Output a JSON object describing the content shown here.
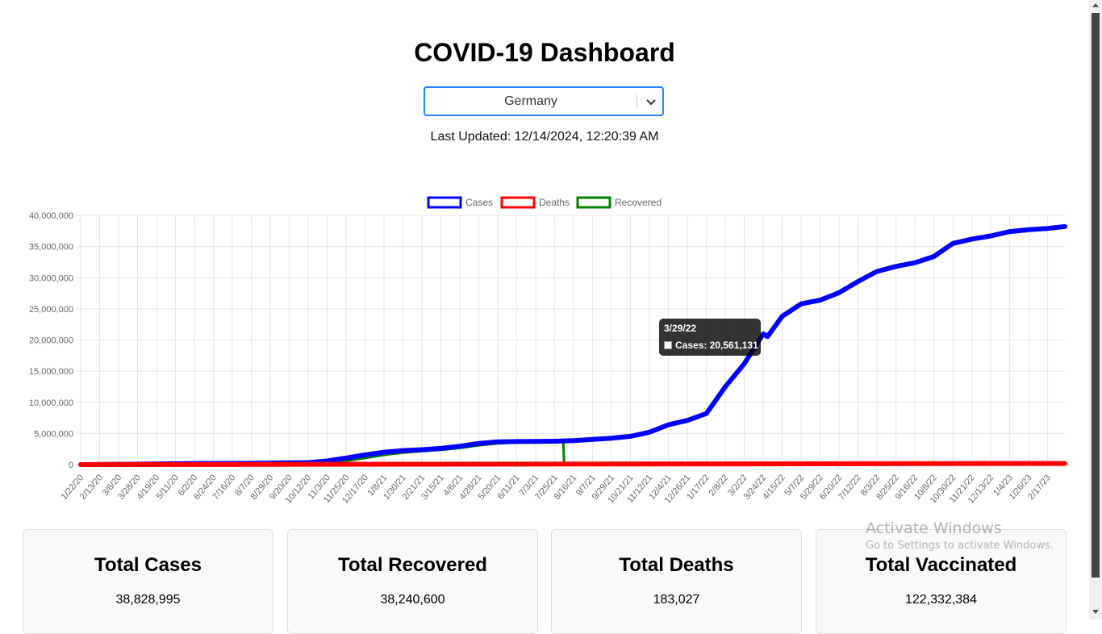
{
  "header": {
    "title": "COVID-19 Dashboard"
  },
  "country_select": {
    "value": "Germany",
    "icon": "chevron-down-icon"
  },
  "last_updated": "Last Updated: 12/14/2024, 12:20:39 AM",
  "chart_data": {
    "type": "line",
    "title": "",
    "xlabel": "",
    "ylabel": "",
    "ylim": [
      0,
      40000000
    ],
    "y_ticks": [
      "0",
      "5,000,000",
      "10,000,000",
      "15,000,000",
      "20,000,000",
      "25,000,000",
      "30,000,000",
      "35,000,000",
      "40,000,000"
    ],
    "x_tick_labels": [
      "1/22/20",
      "2/13/20",
      "3/6/20",
      "3/28/20",
      "4/19/20",
      "5/11/20",
      "6/2/20",
      "6/24/20",
      "7/16/20",
      "8/7/20",
      "8/29/20",
      "9/20/20",
      "10/12/20",
      "11/3/20",
      "11/25/20",
      "12/17/20",
      "1/8/21",
      "1/30/21",
      "2/21/21",
      "3/15/21",
      "4/6/21",
      "4/28/21",
      "5/20/21",
      "6/11/21",
      "7/3/21",
      "7/25/21",
      "8/16/21",
      "9/7/21",
      "9/29/21",
      "10/21/21",
      "11/12/21",
      "12/4/21",
      "12/26/21",
      "1/17/22",
      "2/8/22",
      "3/2/22",
      "3/24/22",
      "4/15/22",
      "5/7/22",
      "5/29/22",
      "6/20/22",
      "7/12/22",
      "8/3/22",
      "8/25/22",
      "9/16/22",
      "10/8/22",
      "10/30/22",
      "11/21/22",
      "12/13/22",
      "1/4/23",
      "1/26/23",
      "2/17/23"
    ],
    "grid": true,
    "legend": "top-center",
    "series": [
      {
        "name": "Cases",
        "color": "#0000ff",
        "x": [
          "1/22/20",
          "3/28/20",
          "6/2/20",
          "8/7/20",
          "10/12/20",
          "11/3/20",
          "11/25/20",
          "12/17/20",
          "1/8/21",
          "1/30/21",
          "2/21/21",
          "3/15/21",
          "4/6/21",
          "4/28/21",
          "5/20/21",
          "6/11/21",
          "7/3/21",
          "7/25/21",
          "8/16/21",
          "9/7/21",
          "9/29/21",
          "10/21/21",
          "11/12/21",
          "12/4/21",
          "12/26/21",
          "1/17/22",
          "2/8/22",
          "3/2/22",
          "3/24/22",
          "3/29/22",
          "4/15/22",
          "5/7/22",
          "5/29/22",
          "6/20/22",
          "7/12/22",
          "8/3/22",
          "8/25/22",
          "9/16/22",
          "10/8/22",
          "10/30/22",
          "11/21/22",
          "12/13/22",
          "1/4/23",
          "1/26/23",
          "2/17/23",
          "3/9/23"
        ],
        "y": [
          0,
          60000,
          180000,
          210000,
          320000,
          580000,
          1050000,
          1550000,
          2000000,
          2250000,
          2400000,
          2600000,
          2950000,
          3400000,
          3650000,
          3700000,
          3720000,
          3760000,
          3850000,
          4050000,
          4250000,
          4550000,
          5200000,
          6400000,
          7100000,
          8200000,
          12500000,
          16200000,
          21000000,
          20561131,
          23800000,
          25800000,
          26400000,
          27600000,
          29400000,
          31000000,
          31800000,
          32400000,
          33400000,
          35500000,
          36200000,
          36700000,
          37400000,
          37700000,
          37900000,
          38200000
        ]
      },
      {
        "name": "Deaths",
        "color": "#ff0000",
        "x": [
          "1/22/20",
          "3/9/23"
        ],
        "y": [
          0,
          183027
        ]
      },
      {
        "name": "Recovered",
        "color": "#008000",
        "x": [
          "1/22/20",
          "3/28/20",
          "6/2/20",
          "8/7/20",
          "10/12/20",
          "11/3/20",
          "11/25/20",
          "12/17/20",
          "1/8/21",
          "1/30/21",
          "2/21/21",
          "3/15/21",
          "4/6/21",
          "4/28/21",
          "5/20/21",
          "6/11/21",
          "7/3/21",
          "7/25/21",
          "8/4/21",
          "8/5/21",
          "8/16/21",
          "3/9/23"
        ],
        "y": [
          0,
          50000,
          160000,
          190000,
          280000,
          380000,
          600000,
          1050000,
          1550000,
          1900000,
          2150000,
          2350000,
          2650000,
          3100000,
          3400000,
          3550000,
          3600000,
          3650000,
          3680000,
          0,
          0,
          0
        ]
      }
    ],
    "tooltip": {
      "title": "3/29/22",
      "body": "Cases: 20,561,131"
    }
  },
  "stats": [
    {
      "title": "Total Cases",
      "value": "38,828,995"
    },
    {
      "title": "Total Recovered",
      "value": "38,240,600"
    },
    {
      "title": "Total Deaths",
      "value": "183,027"
    },
    {
      "title": "Total Vaccinated",
      "value": "122,332,384"
    }
  ],
  "watermark": {
    "line1": "Activate Windows",
    "line2": "Go to Settings to activate Windows."
  }
}
